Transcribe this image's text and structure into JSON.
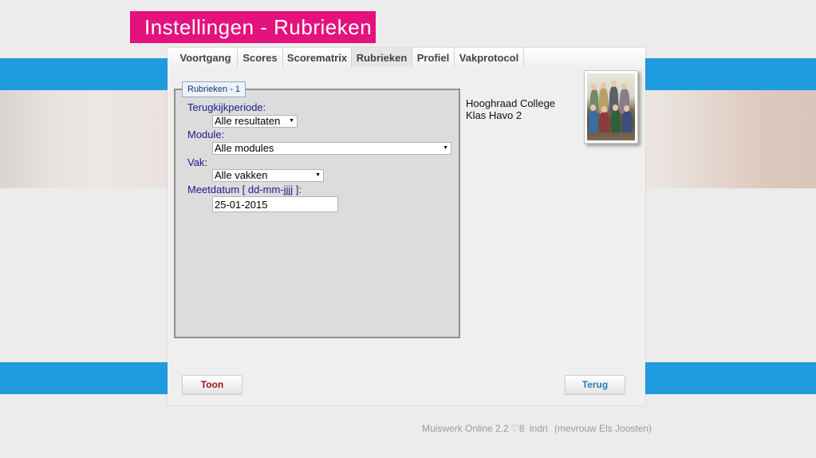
{
  "title": "Instellingen - Rubrieken",
  "tabs": [
    {
      "label": "Voortgang"
    },
    {
      "label": "Scores"
    },
    {
      "label": "Scorematrix"
    },
    {
      "label": "Rubrieken",
      "active": true
    },
    {
      "label": "Profiel"
    },
    {
      "label": "Vakprotocol"
    }
  ],
  "form": {
    "legend": "Rubrieken - 1",
    "periode_label": "Terugkijkperiode:",
    "periode_value": "Alle resultaten",
    "module_label": "Module:",
    "module_value": "Alle modules",
    "vak_label": "Vak:",
    "vak_value": "Alle vakken",
    "meetdatum_label": "Meetdatum [ dd-mm-jjjj ]:",
    "meetdatum_value": "25-01-2015"
  },
  "school": {
    "name": "Hooghraad College",
    "klas": "Klas Havo 2"
  },
  "buttons": {
    "toon": "Toon",
    "terug": "Terug"
  },
  "footer": {
    "app": "Muiswerk Online 2.2",
    "count": "♡8",
    "user": "indri",
    "name": "(mevrouw Els Joosten)"
  },
  "colors": {
    "title_bg": "#e3127d",
    "band": "#1e9cde",
    "label": "#1b1b8a",
    "toon": "#a01515",
    "terug": "#2a7fb8"
  }
}
